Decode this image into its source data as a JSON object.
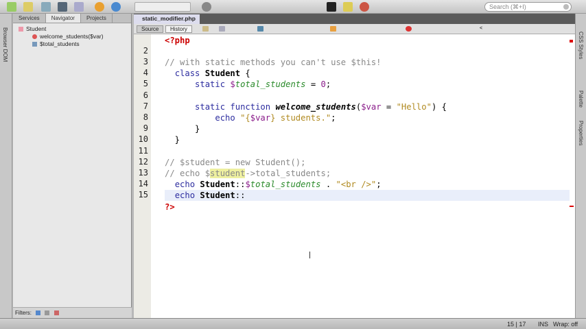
{
  "toolbar": {
    "search_placeholder": "Search (⌘+I)"
  },
  "left_strip": {
    "label": "Browser DOM"
  },
  "left_panel": {
    "tabs": [
      "Services",
      "Navigator",
      "Projects"
    ],
    "tree": {
      "root": "Student",
      "children": [
        "welcome_students($var)",
        "$total_students"
      ]
    },
    "filters_label": "Filters:"
  },
  "editor": {
    "file_tab": "static_modifier.php",
    "source_label": "Source",
    "history_label": "History",
    "lines": [
      {
        "n": "",
        "tokens": [
          [
            "tag",
            "<?php"
          ]
        ]
      },
      {
        "n": "2",
        "tokens": []
      },
      {
        "n": "3",
        "tokens": [
          [
            "cm",
            "// with static methods you can't use $this!"
          ]
        ]
      },
      {
        "n": "4",
        "tokens": [
          [
            "pl",
            "  "
          ],
          [
            "kw",
            "class "
          ],
          [
            "cls",
            "Student"
          ],
          [
            "pl",
            " {"
          ]
        ]
      },
      {
        "n": "5",
        "tokens": [
          [
            "pl",
            "      "
          ],
          [
            "kw",
            "static "
          ],
          [
            "var",
            "$"
          ],
          [
            "fld",
            "total_students"
          ],
          [
            "pl",
            " = "
          ],
          [
            "num",
            "0"
          ],
          [
            "pl",
            ";"
          ]
        ]
      },
      {
        "n": "6",
        "tokens": []
      },
      {
        "n": "7",
        "tokens": [
          [
            "pl",
            "      "
          ],
          [
            "kw",
            "static function "
          ],
          [
            "fn",
            "welcome_students"
          ],
          [
            "pl",
            "("
          ],
          [
            "var",
            "$var"
          ],
          [
            "pl",
            " = "
          ],
          [
            "str",
            "\"Hello\""
          ],
          [
            "pl",
            ") {"
          ]
        ]
      },
      {
        "n": "8",
        "tokens": [
          [
            "pl",
            "          "
          ],
          [
            "kw",
            "echo "
          ],
          [
            "str",
            "\"{"
          ],
          [
            "var",
            "$var"
          ],
          [
            "str",
            "} students.\""
          ],
          [
            "pl",
            ";"
          ]
        ]
      },
      {
        "n": "9",
        "tokens": [
          [
            "pl",
            "      }"
          ]
        ]
      },
      {
        "n": "10",
        "tokens": [
          [
            "pl",
            "  }"
          ]
        ]
      },
      {
        "n": "11",
        "tokens": []
      },
      {
        "n": "12",
        "tokens": [
          [
            "cm",
            "// $student = new Student();"
          ]
        ]
      },
      {
        "n": "13",
        "tokens": [
          [
            "cm",
            "// echo $"
          ],
          [
            "hl",
            "student"
          ],
          [
            "cm",
            "->total_students;"
          ]
        ]
      },
      {
        "n": "14",
        "tokens": [
          [
            "pl",
            "  "
          ],
          [
            "kw",
            "echo "
          ],
          [
            "cls",
            "Student"
          ],
          [
            "pl",
            "::"
          ],
          [
            "var",
            "$"
          ],
          [
            "fld",
            "total_students"
          ],
          [
            "pl",
            " . "
          ],
          [
            "str",
            "\"<br />\""
          ],
          [
            "pl",
            ";"
          ]
        ]
      },
      {
        "n": "15",
        "tokens": [
          [
            "pl",
            "  "
          ],
          [
            "kw",
            "echo "
          ],
          [
            "cls",
            "Student"
          ],
          [
            "pl",
            "::"
          ]
        ]
      },
      {
        "n": "",
        "tokens": [
          [
            "tag",
            "?>"
          ]
        ]
      }
    ]
  },
  "right_strip": {
    "labels": [
      "CSS Styles",
      "Palette",
      "Properties"
    ]
  },
  "status": {
    "position": "15 | 17",
    "mode": "INS",
    "wrap": "Wrap: off"
  }
}
